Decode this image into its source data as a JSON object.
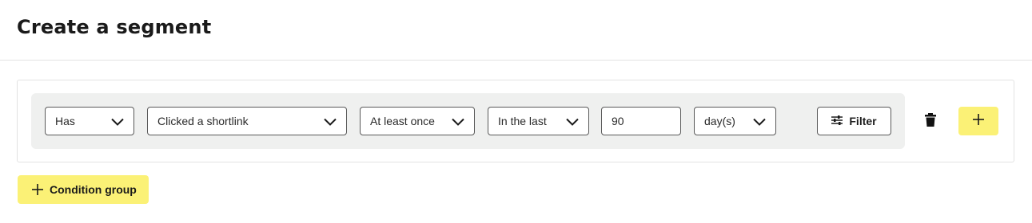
{
  "page": {
    "title": "Create a segment"
  },
  "condition": {
    "has_select": "Has",
    "event_select": "Clicked a shortlink",
    "frequency_select": "At least once",
    "period_select": "In the last",
    "amount_input": "90",
    "unit_select": "day(s)",
    "filter_label": "Filter"
  },
  "actions": {
    "condition_group_label": "Condition group"
  },
  "colors": {
    "accent": "#fbf176",
    "row_background": "#eff0ef",
    "border": "#595959"
  },
  "icons": [
    "chevron-down-icon",
    "sliders-icon",
    "trash-icon",
    "plus-icon"
  ]
}
